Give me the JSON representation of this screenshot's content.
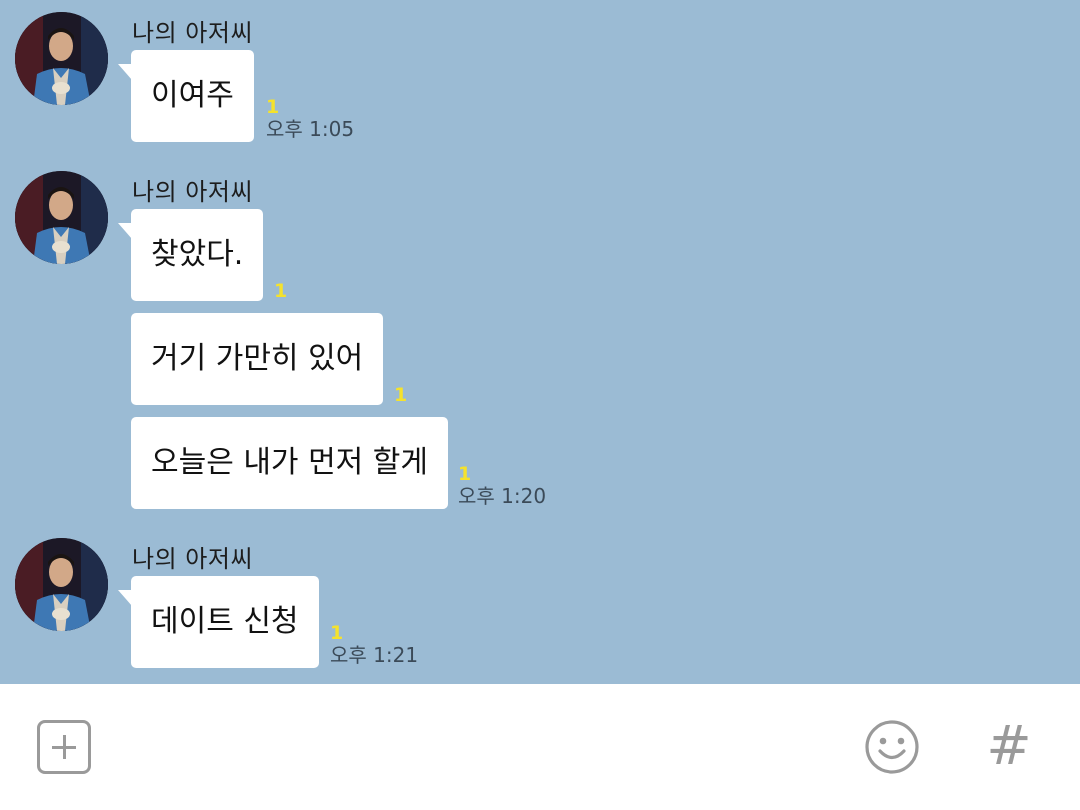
{
  "colors": {
    "chat_background": "#9bbbd4",
    "bubble": "#ffffff",
    "unread_count": "#f5e22c",
    "icon_gray": "#9a9a9a"
  },
  "messages": [
    {
      "sender": "나의 아저씨",
      "text": "이여주",
      "unread": "1",
      "time": "오후 1:05"
    },
    {
      "sender": "나의 아저씨",
      "text": "찾았다.",
      "unread": "1",
      "time": ""
    },
    {
      "sender": "",
      "text": "거기 가만히 있어",
      "unread": "1",
      "time": ""
    },
    {
      "sender": "",
      "text": "오늘은 내가 먼저 할게",
      "unread": "1",
      "time": "오후 1:20"
    },
    {
      "sender": "나의 아저씨",
      "text": "데이트 신청",
      "unread": "1",
      "time": "오후 1:21"
    }
  ],
  "input_bar": {
    "attach_icon": "plus-square-icon",
    "emoji_icon": "smiley-icon",
    "hash_icon": "hash-icon",
    "hash_label": "#"
  }
}
